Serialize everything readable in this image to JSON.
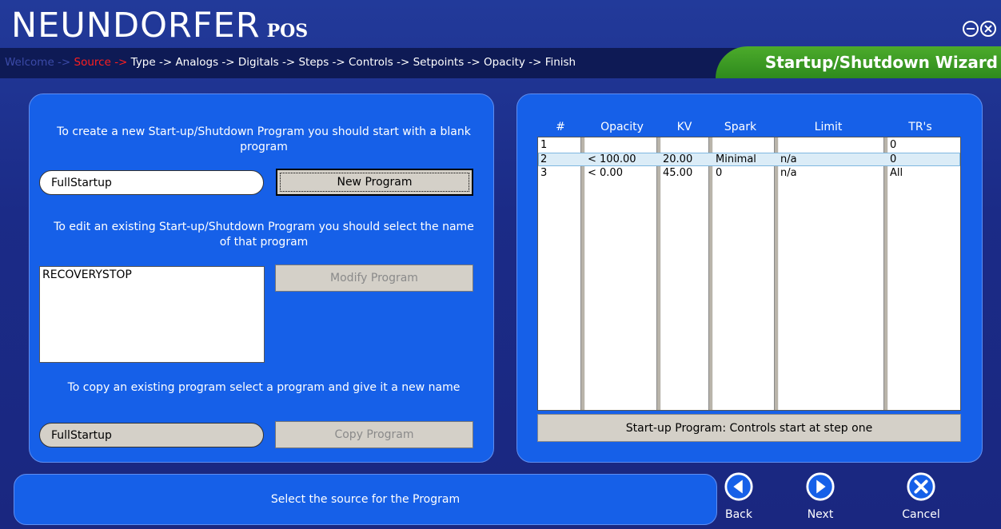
{
  "app": {
    "brand": "NEUNDORFER",
    "brand_sub": "POS",
    "wizard_title": "Startup/Shutdown Wizard"
  },
  "breadcrumbs": {
    "done": "Welcome -> ",
    "current": "Source -> ",
    "remaining": "Type -> Analogs -> Digitals -> Steps -> Controls -> Setpoints -> Opacity -> Finish"
  },
  "left": {
    "new_text": "To create a new Start-up/Shutdown Program you should start with a blank program",
    "new_input_value": "FullStartup",
    "new_button": "New Program",
    "edit_text": "To edit an existing Start-up/Shutdown Program you should select the name of that program",
    "programs": [
      "RECOVERYSTOP"
    ],
    "modify_button": "Modify Program",
    "copy_text": "To copy an existing program select a program and give it a new name",
    "copy_input_value": "FullStartup",
    "copy_button": "Copy Program"
  },
  "table": {
    "columns": [
      "#",
      "Opacity",
      "KV",
      "Spark",
      "Limit",
      "TR's"
    ],
    "rows": [
      [
        "1",
        "",
        "",
        "",
        "",
        "0"
      ],
      [
        "2",
        "< 100.00",
        "20.00",
        "Minimal",
        "n/a",
        "0"
      ],
      [
        "3",
        "< 0.00",
        "45.00",
        "0",
        "n/a",
        "All"
      ]
    ],
    "selected_row": 2,
    "status": "Start-up Program: Controls start at step one"
  },
  "footer": {
    "message": "Select the source for the Program",
    "back": "Back",
    "next": "Next",
    "cancel": "Cancel"
  },
  "colors": {
    "background": "#1b2b87",
    "panel": "#1660e8",
    "wizard_tab": "#3a9a22",
    "current_step": "#ff1f1f"
  }
}
